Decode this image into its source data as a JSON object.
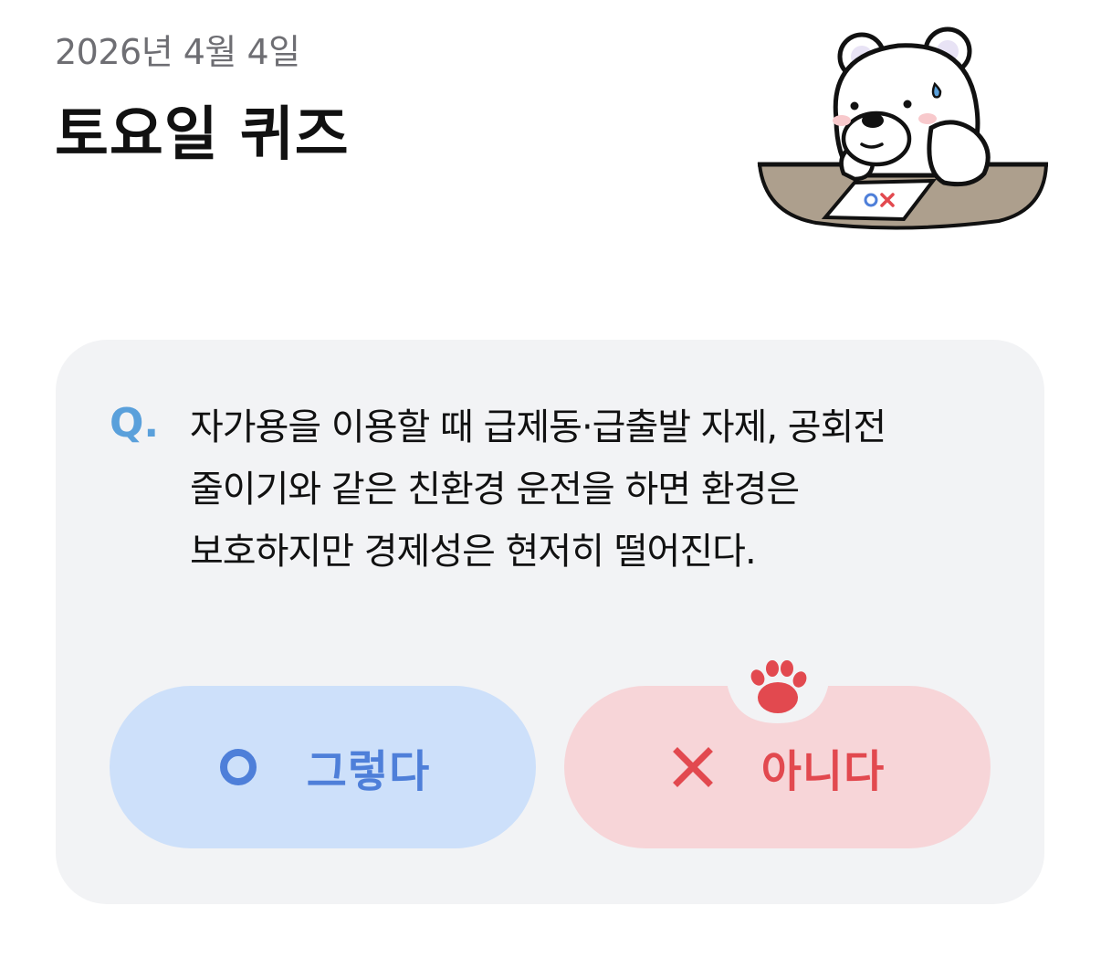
{
  "header": {
    "date": "2026년 4월 4일",
    "title": "토요일 퀴즈"
  },
  "illustration": {
    "icon": "bear-quiz-illustration",
    "paper_text_o": "O",
    "paper_text_x": "X"
  },
  "quiz": {
    "q_marker": "Q.",
    "question_lines": [
      "자가용을 이용할 때 급제동·급출발 자제, 공회전",
      "줄이기와 같은 친환경 운전을 하면 환경은",
      "보호하지만 경제성은 현저히 떨어진다."
    ]
  },
  "answers": {
    "yes": {
      "label": "그렇다",
      "icon": "circle-o-icon",
      "color": "#4e7fd9",
      "bg": "#cde0fa"
    },
    "no": {
      "label": "아니다",
      "icon": "x-mark-icon",
      "color": "#e2494f",
      "bg": "#f7d5d8"
    },
    "badge_icon": "paw-icon"
  },
  "colors": {
    "accent_q": "#5aa0db",
    "card_bg": "#f2f3f5"
  }
}
